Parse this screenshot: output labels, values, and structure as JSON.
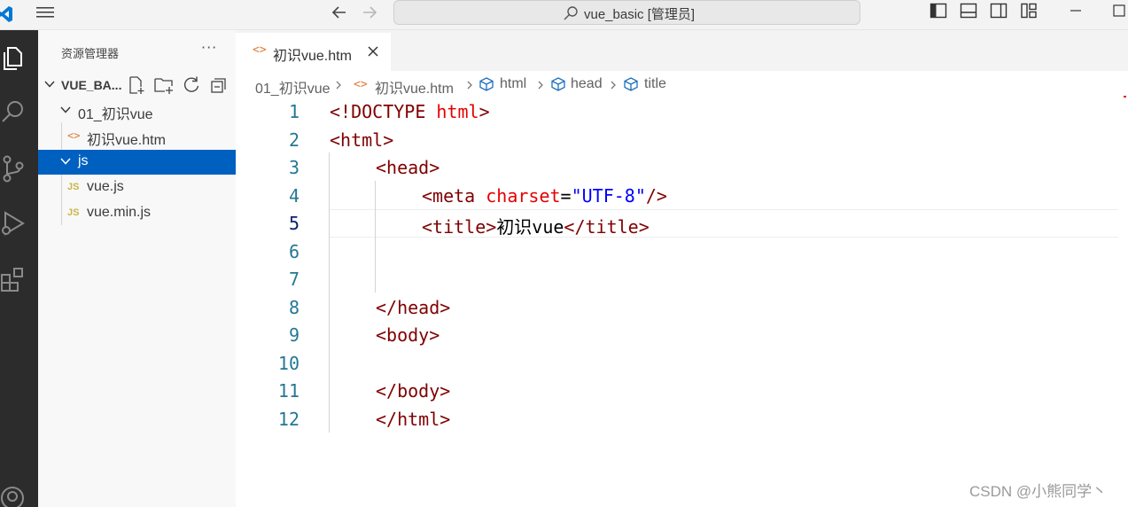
{
  "window": {
    "command_center": "vue_basic [管理员]"
  },
  "sidebar": {
    "title": "资源管理器",
    "more": "···",
    "root_folder": "VUE_BA...",
    "tree": [
      {
        "label": "01_初识vue",
        "type": "folder",
        "expanded": true
      },
      {
        "label": "初识vue.htm",
        "type": "html",
        "icon": "<>"
      },
      {
        "label": "js",
        "type": "folder",
        "expanded": true,
        "selected": true
      },
      {
        "label": "vue.js",
        "type": "js",
        "icon": "JS"
      },
      {
        "label": "vue.min.js",
        "type": "js",
        "icon": "JS"
      }
    ]
  },
  "tabs": [
    {
      "label": "初识vue.htm",
      "icon": "<>",
      "active": true
    }
  ],
  "breadcrumbs": [
    "01_初识vue",
    "初识vue.htm",
    "html",
    "head",
    "title"
  ],
  "editor": {
    "active_line": 5,
    "line_numbers": [
      "1",
      "2",
      "3",
      "4",
      "5",
      "6",
      "7",
      "8",
      "9",
      "10",
      "11",
      "12"
    ],
    "lines": {
      "l1": {
        "tag1": "<!DOCTYPE",
        "attr": " html",
        "tag2": ">"
      },
      "l2": {
        "tag": "<html>"
      },
      "l3": {
        "tag": "<head>"
      },
      "l4": {
        "tag1": "<meta",
        "attr": " charset",
        "eq": "=",
        "str": "\"UTF-8\"",
        "tag2": "/>"
      },
      "l5": {
        "tag1": "<title>",
        "text": "初识vue",
        "tag2": "</title>"
      },
      "l8": {
        "tag": "</head>"
      },
      "l9": {
        "tag": "<body>"
      },
      "l11": {
        "tag": "</body>"
      },
      "l12": {
        "tag": "</html>"
      }
    }
  },
  "watermark": "CSDN @小熊同学丶",
  "colors": {
    "activity_bar": "#2c2c2c",
    "selection": "#0060c0",
    "tag": "#800000",
    "attribute": "#e50000",
    "string": "#0000ff",
    "line_number": "#237893"
  }
}
